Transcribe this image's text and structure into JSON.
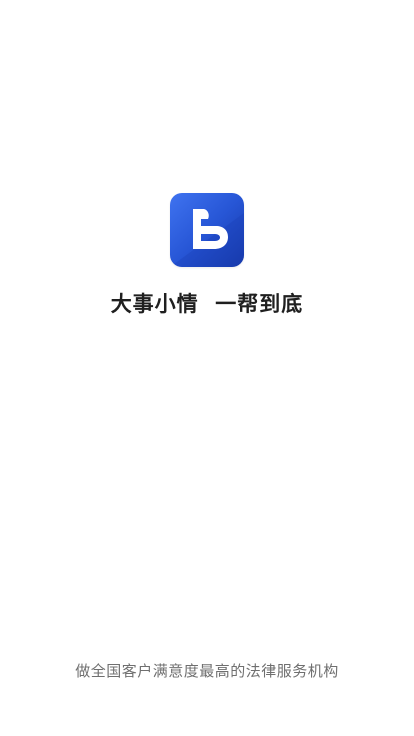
{
  "splash": {
    "logo_icon": "b-logo-icon",
    "slogan": "大事小情  一帮到底",
    "footer_text": "做全国客户满意度最高的法律服务机构"
  },
  "colors": {
    "background": "#ffffff",
    "logo_gradient_start": "#3f73f0",
    "logo_gradient_end": "#1637a6",
    "slogan_text": "#1f1f1f",
    "footer_text": "#6f6f6f"
  }
}
